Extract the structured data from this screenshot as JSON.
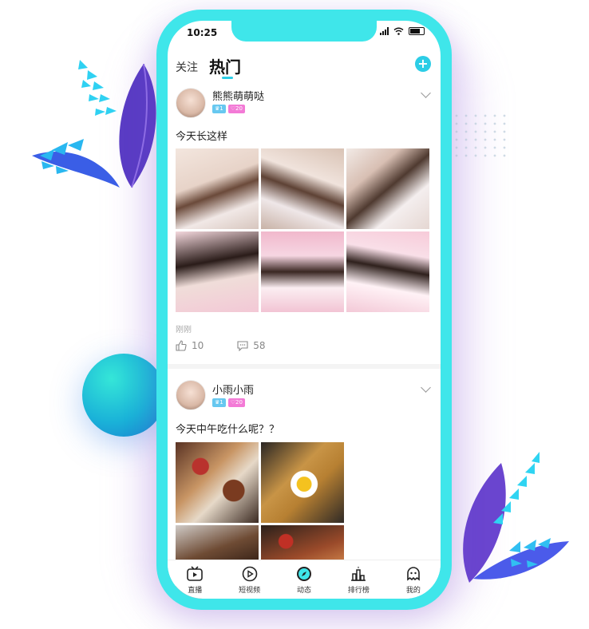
{
  "status_bar": {
    "time": "10:25"
  },
  "header": {
    "tab_follow": "关注",
    "tab_hot": "热门",
    "add_icon": "plus-icon"
  },
  "posts": [
    {
      "username": "熊熊萌萌哒",
      "level": "1",
      "fans": "20",
      "text": "今天长这样",
      "time": "刚刚",
      "likes": "10",
      "comments": "58"
    },
    {
      "username": "小雨小雨",
      "level": "1",
      "fans": "20",
      "text": "今天中午吃什么呢？？"
    }
  ],
  "nav": [
    {
      "label": "直播",
      "icon": "tv-icon"
    },
    {
      "label": "短视频",
      "icon": "play-circle-icon"
    },
    {
      "label": "动态",
      "icon": "compass-icon"
    },
    {
      "label": "排行榜",
      "icon": "ranking-icon"
    },
    {
      "label": "我的",
      "icon": "profile-icon"
    }
  ],
  "colors": {
    "accent": "#3fe6ea",
    "badge_level": "#67c8f0",
    "badge_fans": "#f37ad6"
  }
}
